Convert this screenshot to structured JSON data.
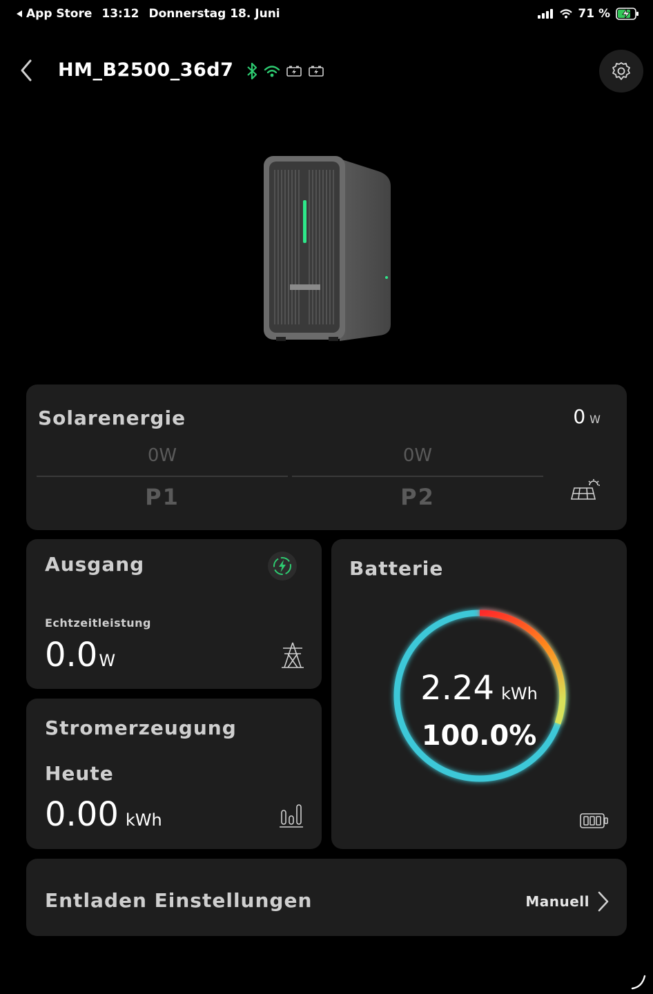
{
  "status_bar": {
    "back_app": "App Store",
    "time": "13:12",
    "date": "Donnerstag 18. Juni",
    "battery_percent": "71 %"
  },
  "header": {
    "device_name": "HM_B2500_36d7",
    "icons": [
      "bluetooth-icon",
      "wifi-icon",
      "battery-pack-1-icon",
      "battery-pack-2-icon"
    ],
    "accent_color": "#2ecc71"
  },
  "solar": {
    "title": "Solarenergie",
    "total_value": "0",
    "total_unit": "W",
    "panels": [
      {
        "name": "P1",
        "value": "0W"
      },
      {
        "name": "P2",
        "value": "0W"
      }
    ]
  },
  "ausgang": {
    "title": "Ausgang",
    "label": "Echtzeitleistung",
    "value": "0.0",
    "unit": "W"
  },
  "stromerzeugung": {
    "title": "Stromerzeugung",
    "label": "Heute",
    "value": "0.00",
    "unit": "kWh"
  },
  "batterie": {
    "title": "Batterie",
    "energy_value": "2.24",
    "energy_unit": "kWh",
    "percent": "100.0%",
    "ring_colors": [
      "#ff2a2a",
      "#ff9a1e",
      "#3ec8d8"
    ]
  },
  "entladen": {
    "title": "Entladen Einstellungen",
    "mode": "Manuell"
  }
}
